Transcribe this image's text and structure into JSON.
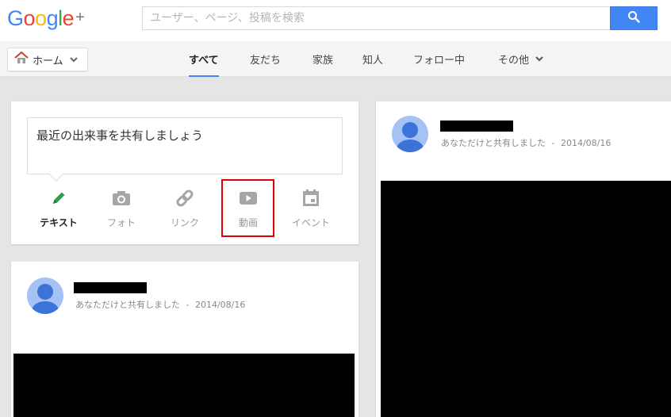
{
  "brand": {
    "letters": [
      {
        "char": "G",
        "color": "#4285f4"
      },
      {
        "char": "o",
        "color": "#ea4335"
      },
      {
        "char": "o",
        "color": "#fbbc05"
      },
      {
        "char": "g",
        "color": "#4285f4"
      },
      {
        "char": "l",
        "color": "#34a853"
      },
      {
        "char": "e",
        "color": "#ea4335"
      }
    ],
    "plus": "+"
  },
  "search": {
    "placeholder": "ユーザー、ページ、投稿を検索",
    "value": "",
    "button_icon": "search-icon"
  },
  "nav": {
    "home_label": "ホーム",
    "home_icon": "home-icon",
    "tabs": [
      {
        "label": "すべて",
        "active": true
      },
      {
        "label": "友だち",
        "active": false
      },
      {
        "label": "家族",
        "active": false
      },
      {
        "label": "知人",
        "active": false
      },
      {
        "label": "フォロー中",
        "active": false
      },
      {
        "label": "その他",
        "active": false,
        "has_dropdown": true
      }
    ]
  },
  "share": {
    "prompt": "最近の出来事を共有しましょう",
    "buttons": [
      {
        "label": "テキスト",
        "icon": "pencil-icon",
        "active": true
      },
      {
        "label": "フォト",
        "icon": "camera-icon",
        "active": false
      },
      {
        "label": "リンク",
        "icon": "link-icon",
        "active": false
      },
      {
        "label": "動画",
        "icon": "video-icon",
        "active": false,
        "highlighted": true
      },
      {
        "label": "イベント",
        "icon": "calendar-icon",
        "active": false
      }
    ]
  },
  "posts": [
    {
      "author": "",
      "visibility": "あなただけと共有しました",
      "separator": "-",
      "date": "2014/08/16"
    },
    {
      "author": "",
      "visibility": "あなただけと共有しました",
      "separator": "-",
      "date": "2014/08/16"
    }
  ],
  "colors": {
    "accent": "#4285f4",
    "highlight": "#e00000",
    "pencil": "#2e9e4f"
  }
}
